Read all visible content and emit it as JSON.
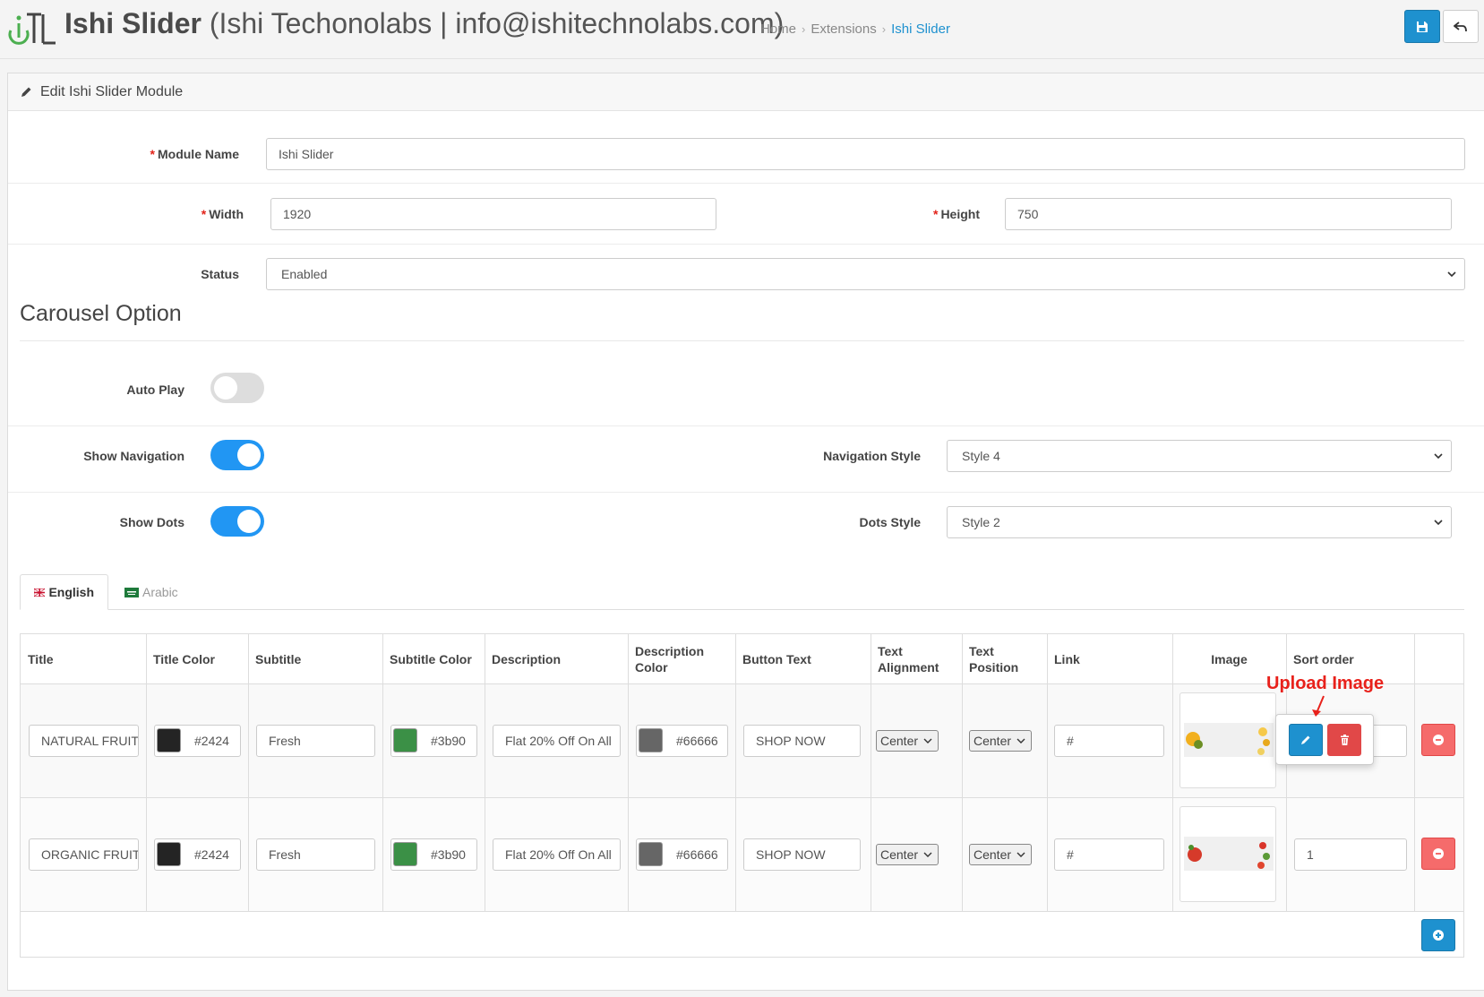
{
  "header": {
    "title_bold": "Ishi Slider",
    "title_rest": "(Ishi Techonolabs | info@ishitechnolabs.com)",
    "breadcrumb": [
      "Home",
      "Extensions",
      "Ishi Slider"
    ],
    "save_icon": "save-icon",
    "back_icon": "reply-icon"
  },
  "panel": {
    "heading": "Edit Ishi Slider Module"
  },
  "form": {
    "module_name_label": "Module Name",
    "module_name_value": "Ishi Slider",
    "width_label": "Width",
    "width_value": "1920",
    "height_label": "Height",
    "height_value": "750",
    "status_label": "Status",
    "status_value": "Enabled"
  },
  "carousel": {
    "title": "Carousel Option",
    "auto_play_label": "Auto Play",
    "auto_play": false,
    "show_navigation_label": "Show Navigation",
    "show_navigation": true,
    "navigation_style_label": "Navigation Style",
    "navigation_style_value": "Style 4",
    "show_dots_label": "Show Dots",
    "show_dots": true,
    "dots_style_label": "Dots Style",
    "dots_style_value": "Style 2"
  },
  "tabs": [
    {
      "label": "English",
      "active": true
    },
    {
      "label": "Arabic",
      "active": false
    }
  ],
  "table": {
    "headers": {
      "title": "Title",
      "title_color": "Title Color",
      "subtitle": "Subtitle",
      "subtitle_color": "Subtitle Color",
      "description": "Description",
      "description_color_1": "Description",
      "description_color_2": "Color",
      "button_text": "Button Text",
      "text_alignment_1": "Text",
      "text_alignment_2": "Alignment",
      "text_position_1": "Text",
      "text_position_2": "Position",
      "link": "Link",
      "image": "Image",
      "sort_order": "Sort order"
    },
    "rows": [
      {
        "title": "NATURAL FRUIT",
        "title_color": "#2424",
        "title_swatch": "#242424",
        "subtitle": "Fresh",
        "subtitle_color": "#3b90",
        "subtitle_swatch": "#3b9046",
        "description": "Flat 20% Off On All",
        "description_color": "#66666",
        "description_swatch": "#666666",
        "button_text": "SHOP NOW",
        "text_alignment": "Center",
        "text_position": "Center",
        "link": "#",
        "sort_order": ""
      },
      {
        "title": "ORGANIC FRUIT",
        "title_color": "#2424",
        "title_swatch": "#242424",
        "subtitle": "Fresh",
        "subtitle_color": "#3b90",
        "subtitle_swatch": "#3b9046",
        "description": "Flat 20% Off On All",
        "description_color": "#66666",
        "description_swatch": "#666666",
        "button_text": "SHOP NOW",
        "text_alignment": "Center",
        "text_position": "Center",
        "link": "#",
        "sort_order": "1"
      }
    ]
  },
  "annotation": {
    "upload_image": "Upload Image"
  },
  "colors": {
    "primary": "#1e91cf",
    "danger": "#f56b6b",
    "toggle_on": "#2196f3",
    "required": "#e2231a",
    "annotation": "#e8211b"
  }
}
